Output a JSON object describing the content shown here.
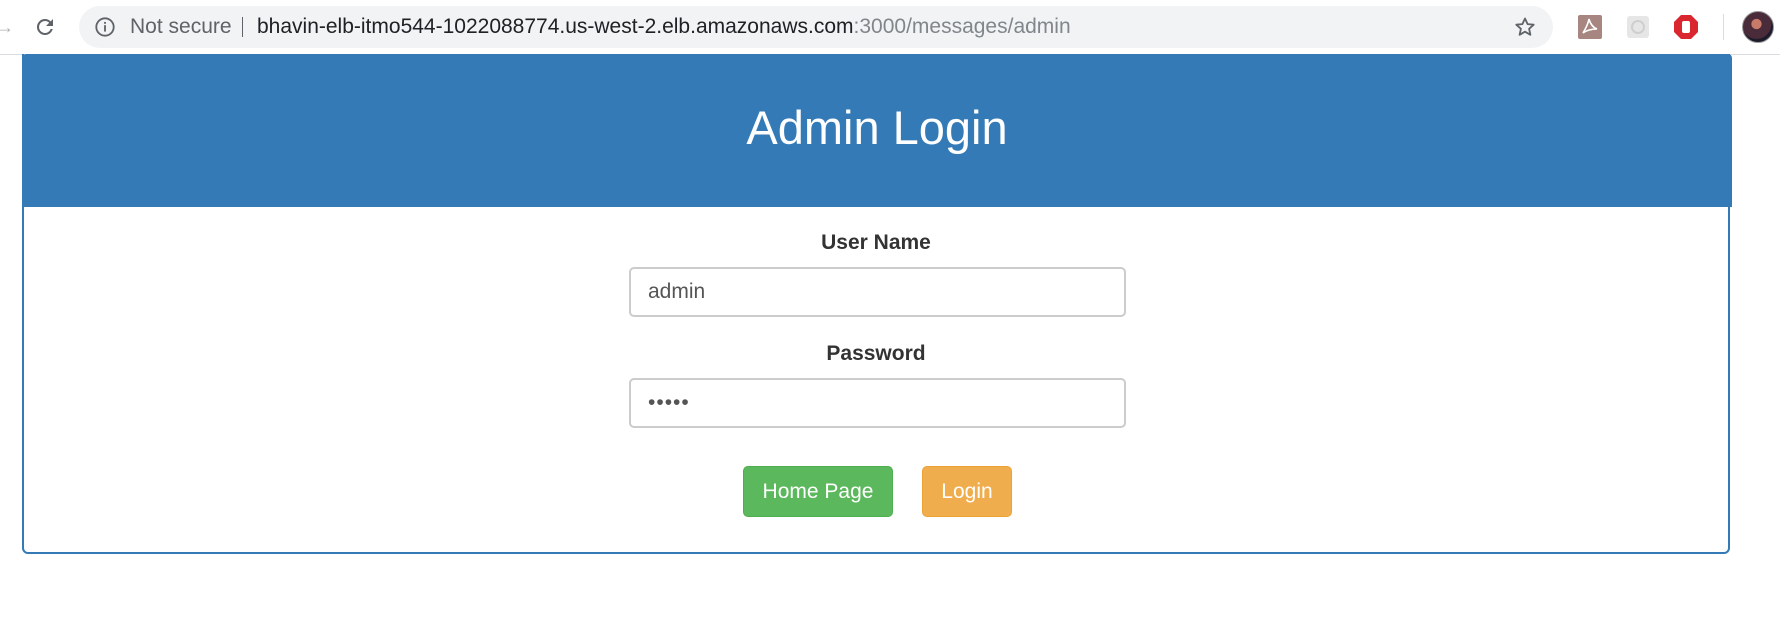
{
  "browser": {
    "security_label": "Not secure",
    "url_host": "bhavin-elb-itmo544-1022088774.us-west-2.elb.amazonaws.com",
    "url_path": ":3000/messages/admin"
  },
  "panel": {
    "title": "Admin Login",
    "accent_color": "#337ab7"
  },
  "form": {
    "username_label": "User Name",
    "username_value": "admin",
    "password_label": "Password",
    "password_value": "admin",
    "home_button_label": "Home Page",
    "home_button_color": "#5cb85c",
    "login_button_label": "Login",
    "login_button_color": "#f0ad4e"
  }
}
